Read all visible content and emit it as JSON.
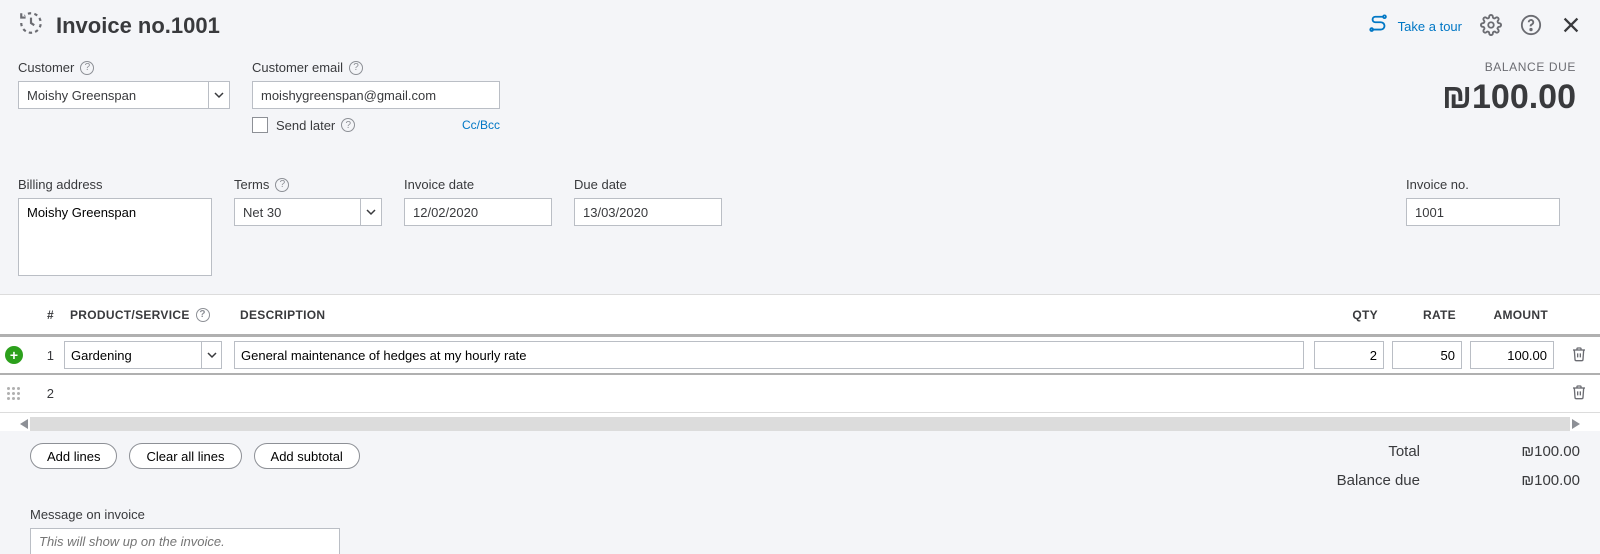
{
  "header": {
    "title": "Invoice no.1001",
    "take_tour": "Take a tour"
  },
  "balance": {
    "label": "BALANCE DUE",
    "amount": "₪100.00"
  },
  "customer": {
    "label": "Customer",
    "value": "Moishy Greenspan",
    "email_label": "Customer email",
    "email_value": "moishygreenspan@gmail.com",
    "send_later": "Send later",
    "ccbcc": "Cc/Bcc"
  },
  "billing": {
    "label": "Billing address",
    "value": "Moishy Greenspan"
  },
  "terms": {
    "label": "Terms",
    "value": "Net 30"
  },
  "invoice_date": {
    "label": "Invoice date",
    "value": "12/02/2020"
  },
  "due_date": {
    "label": "Due date",
    "value": "13/03/2020"
  },
  "invoice_no": {
    "label": "Invoice no.",
    "value": "1001"
  },
  "table": {
    "headers": {
      "num": "#",
      "product": "PRODUCT/SERVICE",
      "desc": "DESCRIPTION",
      "qty": "QTY",
      "rate": "RATE",
      "amount": "AMOUNT"
    },
    "rows": [
      {
        "num": "1",
        "product": "Gardening",
        "desc": "General maintenance of hedges at my hourly rate",
        "qty": "2",
        "rate": "50",
        "amount": "100.00"
      },
      {
        "num": "2",
        "product": "",
        "desc": "",
        "qty": "",
        "rate": "",
        "amount": ""
      }
    ]
  },
  "buttons": {
    "add_lines": "Add lines",
    "clear_lines": "Clear all lines",
    "add_subtotal": "Add subtotal"
  },
  "totals": {
    "total_label": "Total",
    "total_value": "₪100.00",
    "balance_label": "Balance due",
    "balance_value": "₪100.00"
  },
  "message": {
    "label": "Message on invoice",
    "placeholder": "This will show up on the invoice."
  }
}
